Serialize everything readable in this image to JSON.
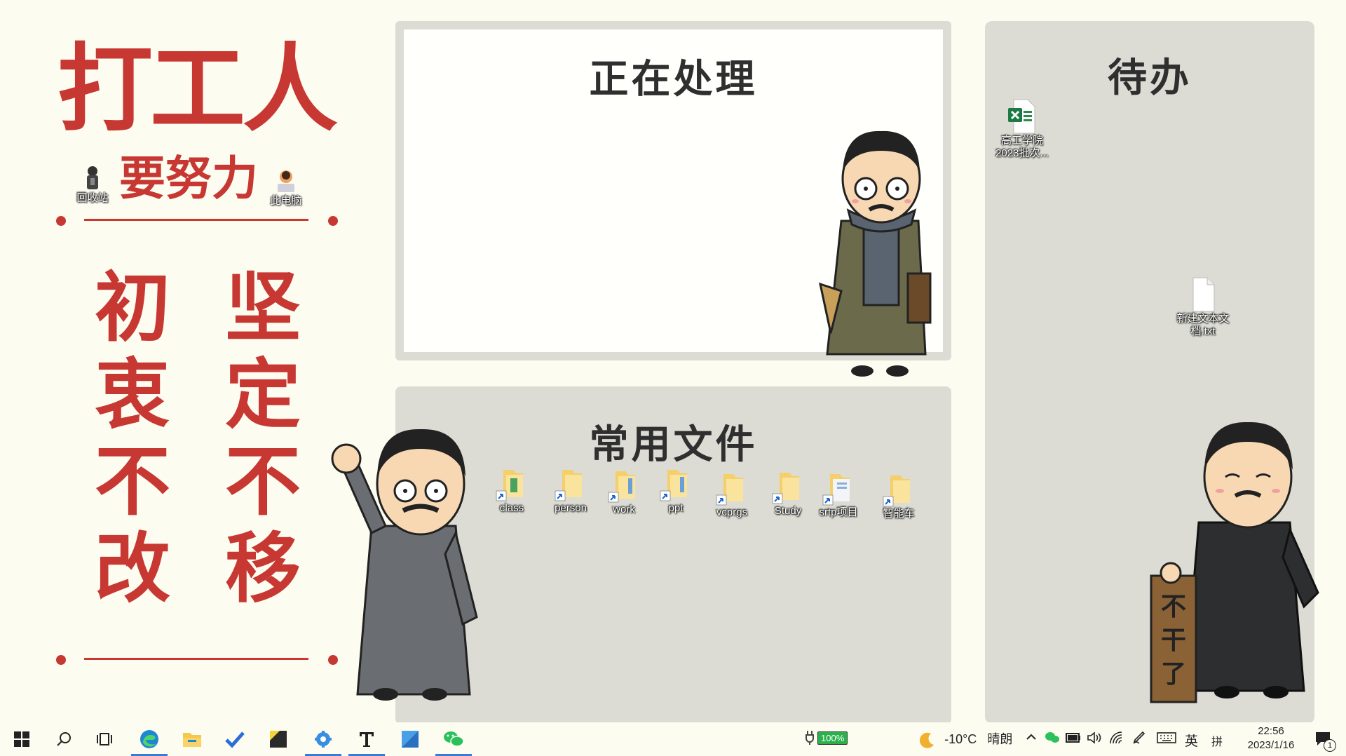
{
  "wallpaper": {
    "title": "打工人",
    "subtitle": "要努力",
    "motto_left": [
      "初",
      "衷",
      "不",
      "改"
    ],
    "motto_right": [
      "坚",
      "定",
      "不",
      "移"
    ],
    "accent_color": "#c73833",
    "sign_text": "不干了"
  },
  "panels": {
    "processing_title": "正在处理",
    "files_title": "常用文件",
    "todo_title": "待办"
  },
  "desktop": {
    "system_icons": [
      {
        "label": "回收站",
        "icon": "recycle-bin-icon"
      },
      {
        "label": "此电脑",
        "icon": "this-pc-icon"
      }
    ],
    "file_shortcuts": [
      {
        "label": "class"
      },
      {
        "label": "person"
      },
      {
        "label": "work"
      },
      {
        "label": "ppt"
      },
      {
        "label": "vcprgs"
      },
      {
        "label": "Study"
      },
      {
        "label": "srtp项目"
      },
      {
        "label": "智能车"
      }
    ],
    "todo_files": [
      {
        "label": "高工学院2023批次...",
        "icon": "excel-file-icon"
      },
      {
        "label": "新建文本文档.txt",
        "icon": "text-file-icon"
      }
    ]
  },
  "taskbar": {
    "apps": [
      {
        "name": "start",
        "icon": "windows-start-icon"
      },
      {
        "name": "search",
        "icon": "search-icon"
      },
      {
        "name": "task-view",
        "icon": "task-view-icon"
      },
      {
        "name": "edge",
        "icon": "edge-browser-icon"
      },
      {
        "name": "file-explorer",
        "icon": "folder-icon"
      },
      {
        "name": "todo",
        "icon": "checkmark-icon"
      },
      {
        "name": "sticky-notes",
        "icon": "sticky-note-icon"
      },
      {
        "name": "settings-tool",
        "icon": "gear-icon"
      },
      {
        "name": "typora",
        "icon": "typora-icon"
      },
      {
        "name": "paint",
        "icon": "paint-icon"
      },
      {
        "name": "wechat",
        "icon": "wechat-icon"
      }
    ],
    "battery": "100%",
    "weather_temp": "-10°C",
    "weather_desc": "晴朗",
    "ime_lang": "英",
    "ime_mode": "拼",
    "time": "22:56",
    "date": "2023/1/16",
    "notification_count": "1"
  }
}
